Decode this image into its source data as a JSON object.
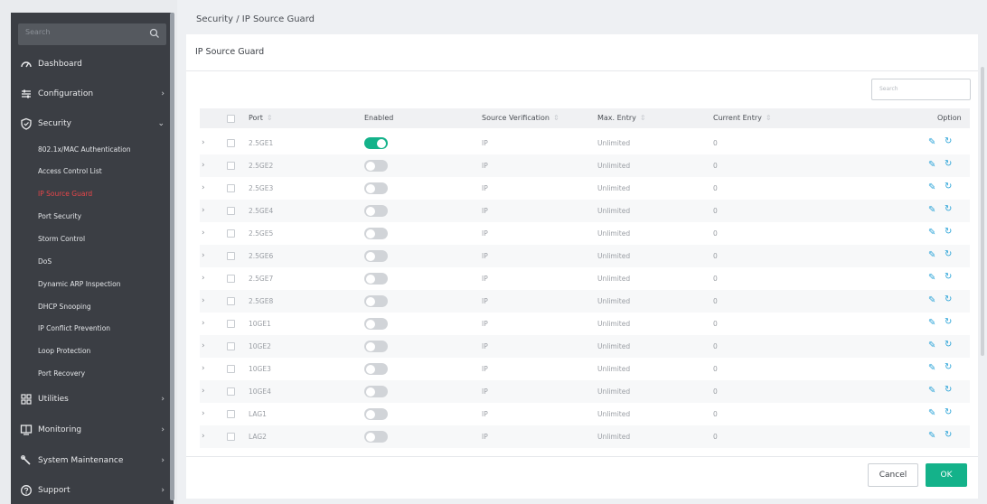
{
  "sidebar": {
    "search_placeholder": "Search",
    "items": [
      {
        "label": "Dashboard",
        "icon": "dashboard-icon",
        "chevron": ""
      },
      {
        "label": "Configuration",
        "icon": "sliders-icon",
        "chevron": "›"
      },
      {
        "label": "Security",
        "icon": "shield-icon",
        "chevron": "⌄"
      },
      {
        "label": "Utilities",
        "icon": "grid-icon",
        "chevron": "›"
      },
      {
        "label": "Monitoring",
        "icon": "monitor-icon",
        "chevron": "›"
      },
      {
        "label": "System Maintenance",
        "icon": "wrench-icon",
        "chevron": "›"
      },
      {
        "label": "Support",
        "icon": "help-icon",
        "chevron": "›"
      }
    ],
    "security_sub": [
      "802.1x/MAC Authentication",
      "Access Control List",
      "IP Source Guard",
      "Port Security",
      "Storm Control",
      "DoS",
      "Dynamic ARP Inspection",
      "DHCP Snooping",
      "IP Conflict Prevention",
      "Loop Protection",
      "Port Recovery"
    ],
    "active_sub": "IP Source Guard"
  },
  "breadcrumb": "Security / IP Source Guard",
  "panel_title": "IP Source Guard",
  "table_search_placeholder": "Search",
  "table": {
    "headers": {
      "port": "Port",
      "enabled": "Enabled",
      "source_verification": "Source Verification",
      "max_entry": "Max. Entry",
      "current_entry": "Current Entry",
      "option": "Option"
    },
    "rows": [
      {
        "port": "2.5GE1",
        "enabled": true,
        "source": "IP",
        "max": "Unlimited",
        "current": "0"
      },
      {
        "port": "2.5GE2",
        "enabled": false,
        "source": "IP",
        "max": "Unlimited",
        "current": "0"
      },
      {
        "port": "2.5GE3",
        "enabled": false,
        "source": "IP",
        "max": "Unlimited",
        "current": "0"
      },
      {
        "port": "2.5GE4",
        "enabled": false,
        "source": "IP",
        "max": "Unlimited",
        "current": "0"
      },
      {
        "port": "2.5GE5",
        "enabled": false,
        "source": "IP",
        "max": "Unlimited",
        "current": "0"
      },
      {
        "port": "2.5GE6",
        "enabled": false,
        "source": "IP",
        "max": "Unlimited",
        "current": "0"
      },
      {
        "port": "2.5GE7",
        "enabled": false,
        "source": "IP",
        "max": "Unlimited",
        "current": "0"
      },
      {
        "port": "2.5GE8",
        "enabled": false,
        "source": "IP",
        "max": "Unlimited",
        "current": "0"
      },
      {
        "port": "10GE1",
        "enabled": false,
        "source": "IP",
        "max": "Unlimited",
        "current": "0"
      },
      {
        "port": "10GE2",
        "enabled": false,
        "source": "IP",
        "max": "Unlimited",
        "current": "0"
      },
      {
        "port": "10GE3",
        "enabled": false,
        "source": "IP",
        "max": "Unlimited",
        "current": "0"
      },
      {
        "port": "10GE4",
        "enabled": false,
        "source": "IP",
        "max": "Unlimited",
        "current": "0"
      },
      {
        "port": "LAG1",
        "enabled": false,
        "source": "IP",
        "max": "Unlimited",
        "current": "0"
      },
      {
        "port": "LAG2",
        "enabled": false,
        "source": "IP",
        "max": "Unlimited",
        "current": "0"
      }
    ]
  },
  "buttons": {
    "cancel": "Cancel",
    "ok": "OK"
  },
  "colors": {
    "accent": "#14b28a",
    "sidebar_bg": "#3b3e44",
    "active_red": "#e9464a",
    "option_icon": "#2aa3d8"
  }
}
